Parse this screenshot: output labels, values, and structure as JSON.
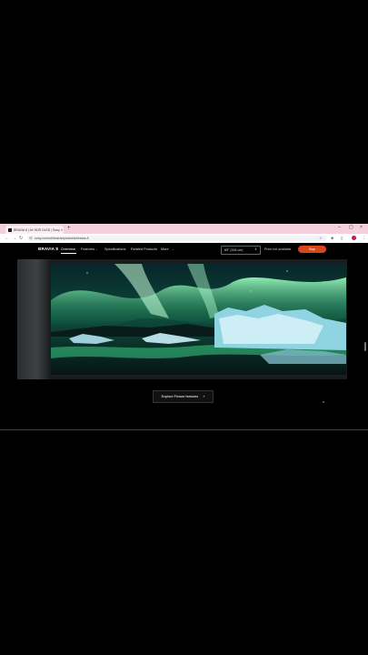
{
  "browser": {
    "tab_title": "BRAVIA 8 | 4K HDR OLED | Sony",
    "tab_close": "×",
    "new_tab": "+",
    "url": "sony.com/uk/bravia/products/bravia-8",
    "window_controls": [
      "–",
      "▢",
      "×"
    ]
  },
  "site": {
    "logo": "BRAVIA 8",
    "nav": [
      "Overview",
      "Features",
      "Specifications",
      "Related Products",
      "More"
    ],
    "size_select": "65\" (164 cm)",
    "price_text": "Price not available",
    "buy_label": "Buy"
  },
  "content": {
    "feature_button": "Explore Picture features",
    "feature_plus": "+",
    "collapse_icon": "^"
  }
}
